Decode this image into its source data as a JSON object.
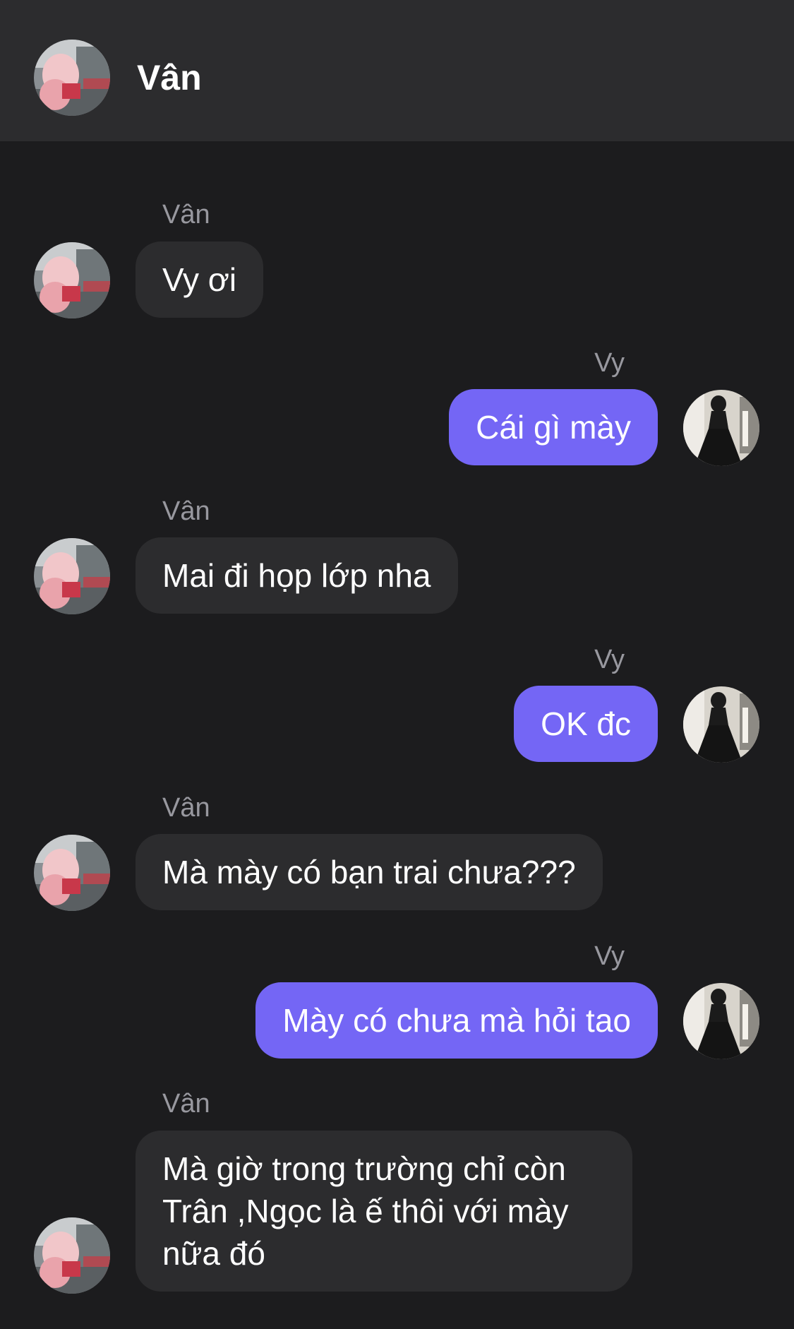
{
  "header": {
    "title": "Vân"
  },
  "messages": [
    {
      "sender": "Vân",
      "text": "Vy ơi"
    },
    {
      "sender": "Vy",
      "text": "Cái gì mày"
    },
    {
      "sender": "Vân",
      "text": "Mai đi họp lớp nha"
    },
    {
      "sender": "Vy",
      "text": "OK đc"
    },
    {
      "sender": "Vân",
      "text": "Mà mày có bạn trai chưa???"
    },
    {
      "sender": "Vy",
      "text": "Mày có chưa mà hỏi tao"
    },
    {
      "sender": "Vân",
      "text": "Mà giờ trong trường chỉ còn Trân ,Ngọc là ế thôi với mày nữa đó"
    }
  ],
  "colors": {
    "background": "#1c1c1e",
    "header_bg": "#2c2c2e",
    "incoming_bubble": "#2c2c2e",
    "outgoing_bubble": "#7466f5",
    "sender_label": "#98989f"
  },
  "icons": {
    "van_avatar": "avatar-photo",
    "vy_avatar": "avatar-photo"
  }
}
